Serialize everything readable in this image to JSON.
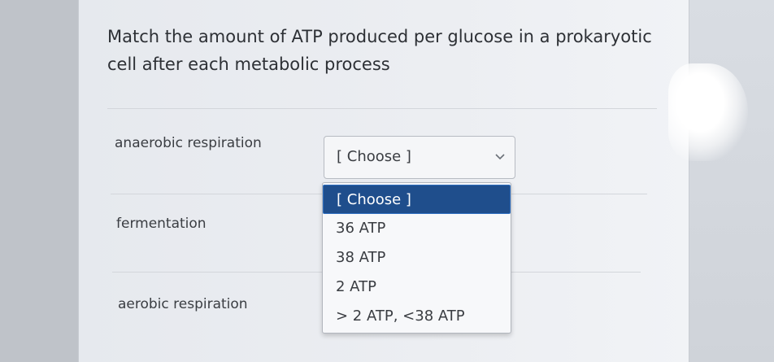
{
  "question": {
    "text": "Match the amount of ATP produced per glucose in a prokaryotic cell after each metabolic process"
  },
  "rows": [
    {
      "label": "anaerobic respiration"
    },
    {
      "label": "fermentation"
    },
    {
      "label": "aerobic respiration"
    }
  ],
  "select": {
    "value": "[ Choose ]"
  },
  "dropdown": {
    "options": [
      "[ Choose ]",
      "36 ATP",
      "38 ATP",
      "2 ATP",
      "> 2 ATP, <38 ATP"
    ],
    "selected_index": 0
  },
  "colors": {
    "highlight": "#1f4e8c",
    "text": "#3a3d42"
  },
  "icons": {
    "select_arrow": "chevron-down-icon"
  }
}
